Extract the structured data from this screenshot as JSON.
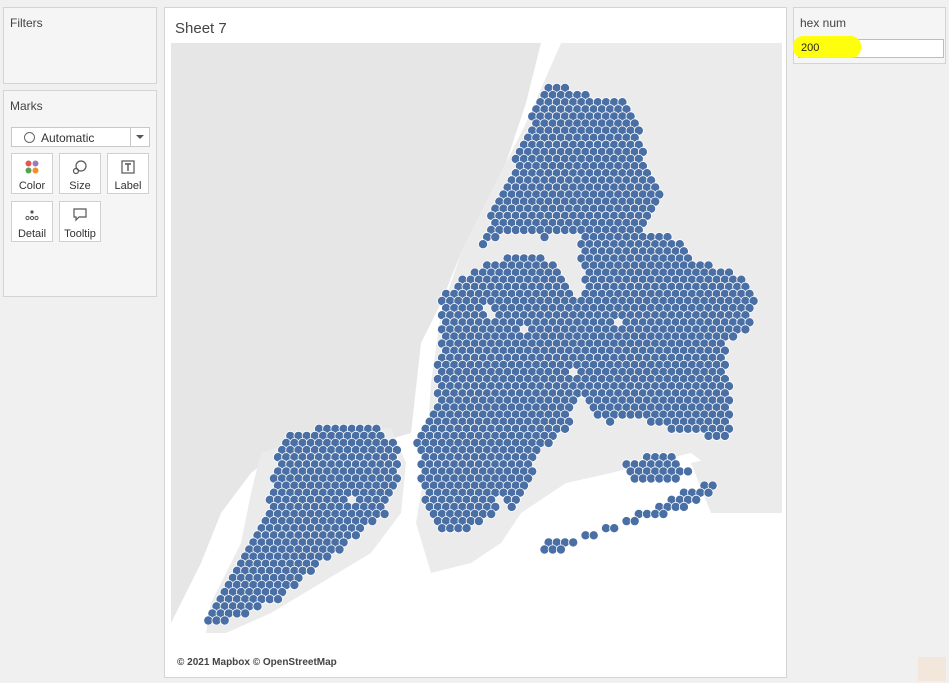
{
  "filters": {
    "title": "Filters"
  },
  "marks": {
    "title": "Marks",
    "type": "Automatic",
    "buttons": [
      {
        "label": "Color",
        "icon": "color-icon"
      },
      {
        "label": "Size",
        "icon": "size-icon"
      },
      {
        "label": "Label",
        "icon": "label-icon"
      },
      {
        "label": "Detail",
        "icon": "detail-icon"
      },
      {
        "label": "Tooltip",
        "icon": "tooltip-icon"
      }
    ]
  },
  "sheet": {
    "title": "Sheet 7",
    "attribution": "© 2021 Mapbox © OpenStreetMap",
    "map": {
      "hex_color": "#4a6fa5",
      "water_color": "#ffffff",
      "land_color": "#e6e6e6"
    }
  },
  "parameter": {
    "title": "hex num",
    "value": "200",
    "highlight_color": "#ffff00"
  }
}
